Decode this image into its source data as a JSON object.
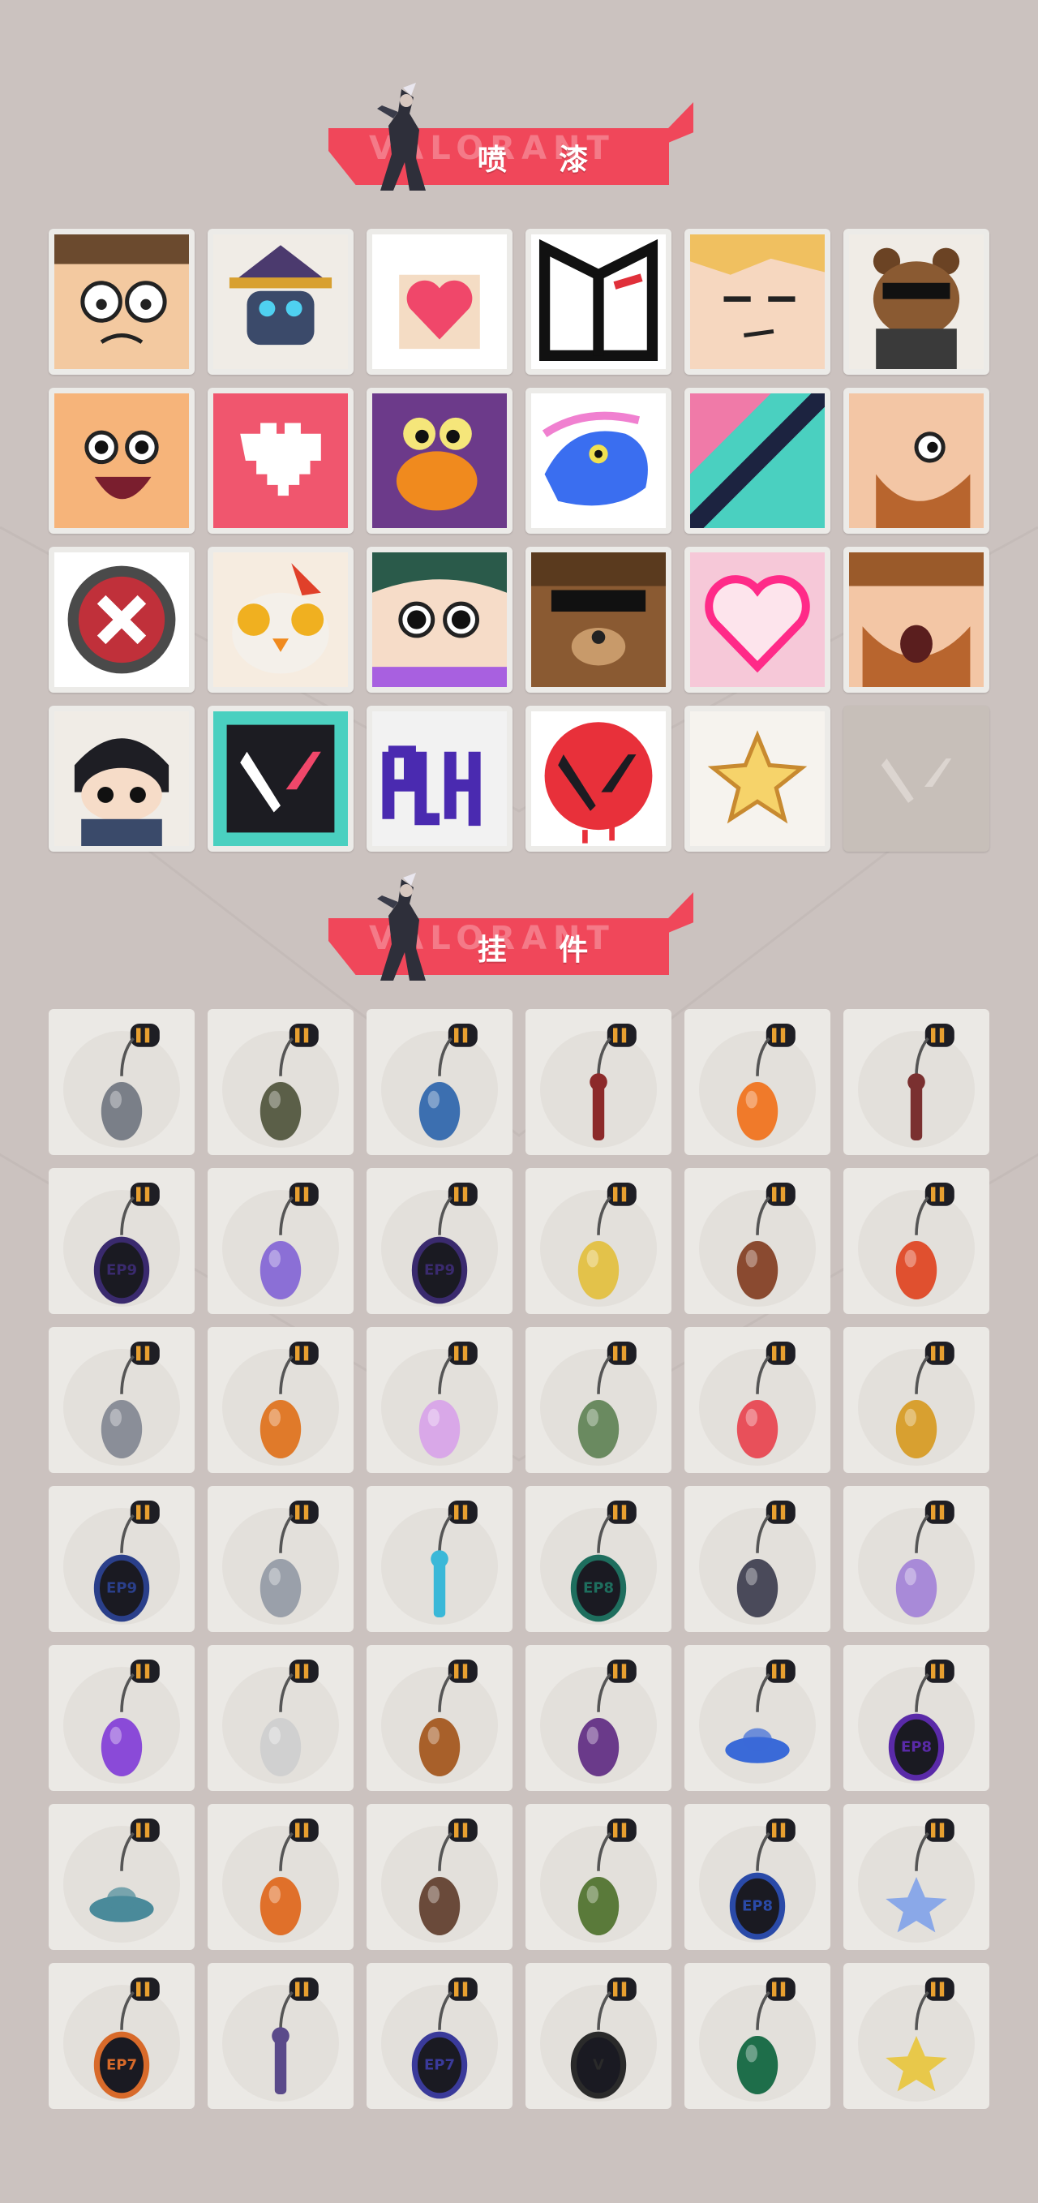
{
  "sections": {
    "sprays_title": "喷 漆",
    "buddies_title": "挂 件",
    "banner_ghost_text": "VALORANT"
  },
  "sprays": [
    {
      "icon": "nerdy-agent-face-spray"
    },
    {
      "icon": "masked-hat-agent-spray"
    },
    {
      "icon": "heart-hands-spray"
    },
    {
      "icon": "white-mask-spray"
    },
    {
      "icon": "smug-blonde-face-spray"
    },
    {
      "icon": "sunglasses-bear-spray"
    },
    {
      "icon": "laughing-face-spray"
    },
    {
      "icon": "pixel-heart-spray"
    },
    {
      "icon": "googly-eye-creature-spray"
    },
    {
      "icon": "blue-dolphin-spray"
    },
    {
      "icon": "slash-pattern-spray"
    },
    {
      "icon": "bearded-man-spray"
    },
    {
      "icon": "red-x-button-spray"
    },
    {
      "icon": "owl-creature-spray"
    },
    {
      "icon": "big-eyed-girl-spray"
    },
    {
      "icon": "cool-bear-face-spray"
    },
    {
      "icon": "neon-heart-spray"
    },
    {
      "icon": "yawning-bearded-spray"
    },
    {
      "icon": "chibi-ninja-spray"
    },
    {
      "icon": "valorant-logo-splash-spray"
    },
    {
      "icon": "purple-graffiti-spray"
    },
    {
      "icon": "red-valorant-logo-spray"
    },
    {
      "icon": "yellow-star-spray"
    },
    {
      "icon": "empty-valorant-slot"
    }
  ],
  "buddies": [
    {
      "icon": "astronaut-charm",
      "color": "#7a7f88"
    },
    {
      "icon": "canteen-charm",
      "color": "#5b5f48"
    },
    {
      "icon": "battery-canister-charm",
      "color": "#3c6fb0"
    },
    {
      "icon": "spiked-dagger-charm",
      "color": "#8c2a2a"
    },
    {
      "icon": "candy-corn-charm",
      "color": "#f07a2a"
    },
    {
      "icon": "rope-knot-charm",
      "color": "#7a3030"
    },
    {
      "icon": "ep9-coin-charm",
      "color": "#3a2a6e"
    },
    {
      "icon": "lava-lamp-charm",
      "color": "#8b6fd6"
    },
    {
      "icon": "ep9-coin-charm",
      "color": "#3a2a6e"
    },
    {
      "icon": "banana-charm",
      "color": "#e3c24a"
    },
    {
      "icon": "popsicle-charm",
      "color": "#8a4a30"
    },
    {
      "icon": "fruit-skewer-charm",
      "color": "#e0502f"
    },
    {
      "icon": "hooded-agent-charm",
      "color": "#8a8e98"
    },
    {
      "icon": "hot-air-balloon-charm",
      "color": "#e07a2a"
    },
    {
      "icon": "pink-hair-charm",
      "color": "#d9a8e8"
    },
    {
      "icon": "robot-vendor-charm",
      "color": "#6a8a60"
    },
    {
      "icon": "watermelon-charm",
      "color": "#e8505a"
    },
    {
      "icon": "bee-hive-charm",
      "color": "#d8a030"
    },
    {
      "icon": "ep9-coin-charm",
      "color": "#2a3f8a"
    },
    {
      "icon": "silver-droplet-charm",
      "color": "#9aa0aa"
    },
    {
      "icon": "blue-tassel-charm",
      "color": "#3ab8d8"
    },
    {
      "icon": "ep8-coin-charm",
      "color": "#1e6e5e"
    },
    {
      "icon": "penguin-claw-charm",
      "color": "#4a4a5a"
    },
    {
      "icon": "jellyfish-charm",
      "color": "#a88ad8"
    },
    {
      "icon": "flame-lotus-charm",
      "color": "#8a4ad8"
    },
    {
      "icon": "shield-outline-charm",
      "color": "#d0d0d0"
    },
    {
      "icon": "pretzel-charm",
      "color": "#a8602a"
    },
    {
      "icon": "purple-fang-charm",
      "color": "#6a3a8a"
    },
    {
      "icon": "manta-ray-charm",
      "color": "#3a6ad8"
    },
    {
      "icon": "ep8-coin-charm",
      "color": "#5a2aa8"
    },
    {
      "icon": "ufo-charm",
      "color": "#4a8a9a"
    },
    {
      "icon": "orange-creature-charm",
      "color": "#e0702a"
    },
    {
      "icon": "radar-box-charm",
      "color": "#6a4a3a"
    },
    {
      "icon": "potted-plant-charm",
      "color": "#5a7a3a"
    },
    {
      "icon": "ep8-coin-charm",
      "color": "#2a4aa8"
    },
    {
      "icon": "snowflake-charm",
      "color": "#8aa8e8"
    },
    {
      "icon": "ep7-coin-charm",
      "color": "#d86a2a"
    },
    {
      "icon": "purple-tassel-charm",
      "color": "#5a4a8a"
    },
    {
      "icon": "ep7-coin-charm",
      "color": "#3a3a9a"
    },
    {
      "icon": "valorant-v-coin-charm",
      "color": "#2a2a2a"
    },
    {
      "icon": "green-gem-charm",
      "color": "#1e6e4a"
    },
    {
      "icon": "star-egg-charm",
      "color": "#e8c84a"
    }
  ],
  "colors": {
    "background": "#cbc2bf",
    "banner": "#f0475a",
    "tile": "#ebe9e5",
    "frame": "#ecebe8"
  }
}
